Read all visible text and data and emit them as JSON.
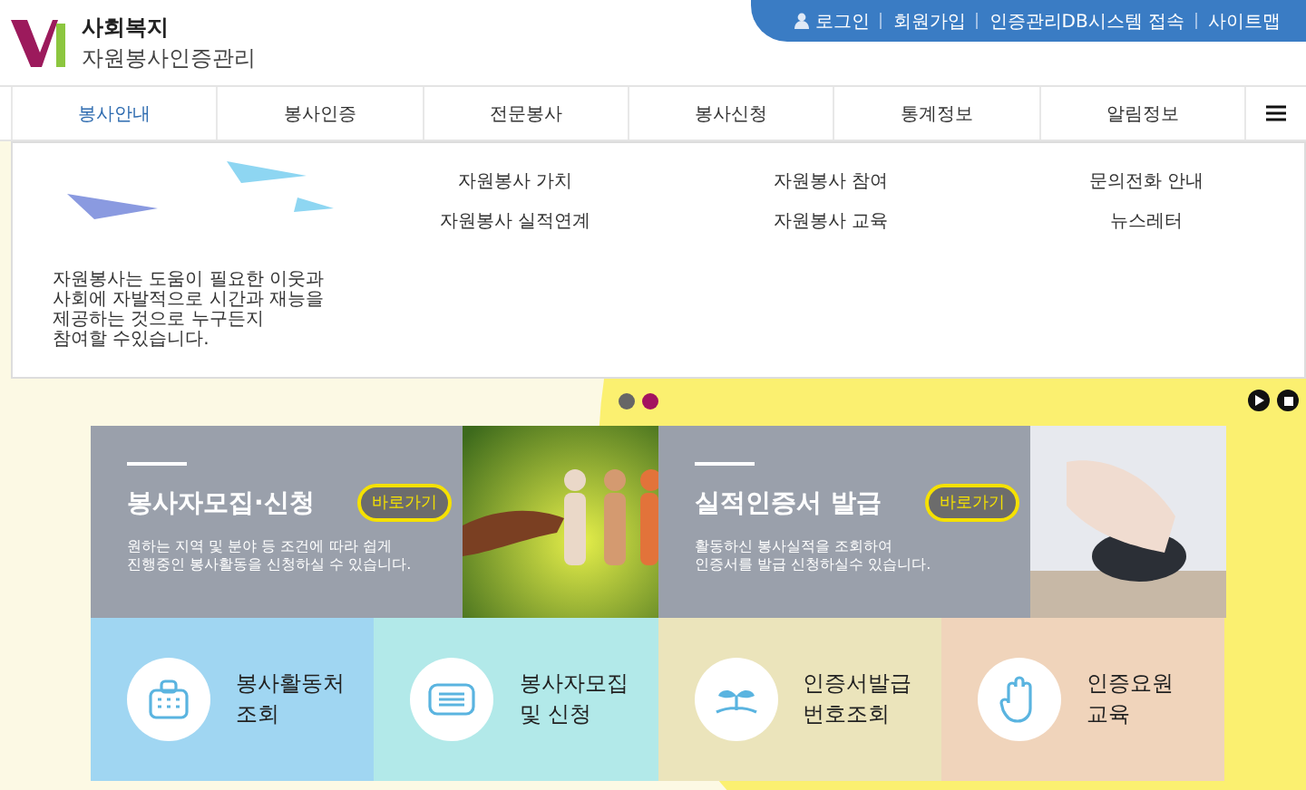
{
  "logo": {
    "title": "사회복지",
    "subtitle": "자원봉사인증관리"
  },
  "top_links": [
    {
      "label": "로그인",
      "kind": "login"
    },
    {
      "label": "회원가입",
      "kind": "link"
    },
    {
      "label": "인증관리DB시스템 접속",
      "kind": "link"
    },
    {
      "label": "사이트맵",
      "kind": "link"
    }
  ],
  "nav": [
    {
      "label": "봉사안내",
      "selected": true
    },
    {
      "label": "봉사인증",
      "selected": false
    },
    {
      "label": "전문봉사",
      "selected": false
    },
    {
      "label": "봉사신청",
      "selected": false
    },
    {
      "label": "통계정보",
      "selected": false
    },
    {
      "label": "알림정보",
      "selected": false
    }
  ],
  "dropdown": {
    "description": "자원봉사는 도움이 필요한 이웃과\n사회에 자발적으로 시간과 재능을\n제공하는 것으로 누구든지\n참여할 수있습니다.",
    "columns": [
      [
        "자원봉사 가치",
        "자원봉사 실적연계"
      ],
      [
        "자원봉사 참여",
        "자원봉사 교육"
      ],
      [
        "문의전화 안내",
        "뉴스레터"
      ]
    ]
  },
  "slider_dots": [
    {
      "selected": false
    },
    {
      "selected": true
    }
  ],
  "features": [
    {
      "title": "봉사자모집·신청",
      "button": "바로가기",
      "description": "원하는 지역 및 분야 등 조건에 따라 쉽게\n진행중인 봉사활동을 신청하실 수 있습니다.",
      "kind": "people"
    },
    {
      "title": "실적인증서 발급",
      "button": "바로가기",
      "description": "활동하신 봉사실적을 조회하여\n인증서를 발급 신청하실수 있습니다.",
      "kind": "mouse"
    }
  ],
  "quick_links": [
    {
      "label": "봉사활동처\n조회",
      "color": "#a0d6f2",
      "kind": "building"
    },
    {
      "label": "봉사자모집\n및 신청",
      "color": "#b2e9e9",
      "kind": "book"
    },
    {
      "label": "인증서발급\n번호조회",
      "color": "#ebe4bb",
      "kind": "sprout"
    },
    {
      "label": "인증요원\n교육",
      "color": "#f0d4bb",
      "kind": "hand"
    }
  ]
}
